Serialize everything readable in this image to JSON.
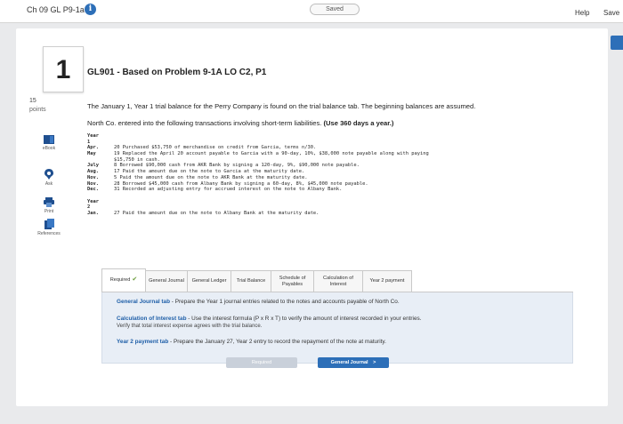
{
  "topbar": {
    "assignment_title": "Ch 09 GL P9-1a",
    "info_glyph": "i",
    "saved_label": "Saved",
    "help_label": "Help",
    "save_label": "Save"
  },
  "question": {
    "number": "1",
    "title": "GL901 - Based on Problem 9-1A LO C2, P1",
    "points_value": "15",
    "points_label": "points",
    "intro_line1": "The January 1, Year 1 trial balance for the Perry Company is found on the trial balance tab. The beginning balances are assumed.",
    "intro_line2": "North Co. entered into the following transactions involving short-term liabilities.",
    "intro_line2_bold": "(Use 360 days a year.)"
  },
  "side_tools": [
    {
      "label": "eBook",
      "icon": "book-icon"
    },
    {
      "label": "Ask",
      "icon": "ask-icon"
    },
    {
      "label": "Print",
      "icon": "print-icon"
    },
    {
      "label": "References",
      "icon": "references-icon"
    }
  ],
  "ledger": {
    "rows": [
      {
        "c1": "Year",
        "c2": ""
      },
      {
        "c1": "1",
        "c2": ""
      },
      {
        "c1": "Apr.",
        "c2": "20 Purchased $53,750 of merchandise on credit from Garcia, terms n/30."
      },
      {
        "c1": "May",
        "c2": "19 Replaced the April 20 account payable to Garcia with a 90-day, 10%, $38,000 note payable along with paying"
      },
      {
        "c1": "",
        "c2": "   $15,750 in cash."
      },
      {
        "c1": "July",
        "c2": " 8 Borrowed $90,000 cash from AKR Bank by signing a 120-day, 9%, $90,000 note payable."
      },
      {
        "c1": "Aug.",
        "c2": "17 Paid the amount due on the note to Garcia at the maturity date."
      },
      {
        "c1": "Nov.",
        "c2": " 5 Paid the amount due on the note to AKR Bank at the maturity date."
      },
      {
        "c1": "Nov.",
        "c2": "28 Borrowed $45,000 cash from Albany Bank by signing a 60-day, 8%, $45,000 note payable."
      },
      {
        "c1": "Dec.",
        "c2": "31 Recorded an adjusting entry for accrued interest on the note to Albany Bank."
      },
      {
        "c1": "",
        "c2": ""
      },
      {
        "c1": "Year",
        "c2": ""
      },
      {
        "c1": "2",
        "c2": ""
      },
      {
        "c1": "Jan.",
        "c2": "27 Paid the amount due on the note to Albany Bank at the maturity date."
      }
    ]
  },
  "tabs": [
    {
      "label": "Required",
      "width": 50,
      "active": true,
      "check": true
    },
    {
      "label": "General Journal",
      "width": 48,
      "active": false,
      "check": false
    },
    {
      "label": "General Ledger",
      "width": 50,
      "active": false,
      "check": false
    },
    {
      "label": "Trial Balance",
      "width": 46,
      "active": false,
      "check": false
    },
    {
      "label": "Schedule of Payables",
      "width": 49,
      "active": false,
      "check": false
    },
    {
      "label": "Calculation of Interest",
      "width": 56,
      "active": false,
      "check": false
    },
    {
      "label": "Year 2 payment",
      "width": 56,
      "active": false,
      "check": false
    }
  ],
  "info_panel": {
    "gj_bold": "General Journal tab",
    "gj_text": " - Prepare the Year 1 journal entries related to the notes and accounts payable of North Co.",
    "ci_bold": "Calculation of Interest tab",
    "ci_text": " - Use the interest formula (P x R x T) to verify the amount of interest recorded in your entries.",
    "ci_sub": "Verify that total interest expense agrees with the trial balance.",
    "y2_bold": "Year 2 payment tab",
    "y2_text": " - Prepare the January 27, Year 2 entry to record the repayment of the note at maturity."
  },
  "nav": {
    "prev_label": "Required",
    "next_label": "General Journal",
    "next_arrow": ">"
  },
  "colors": {
    "accent": "#2d6fb8",
    "panel": "#e8eef6"
  }
}
